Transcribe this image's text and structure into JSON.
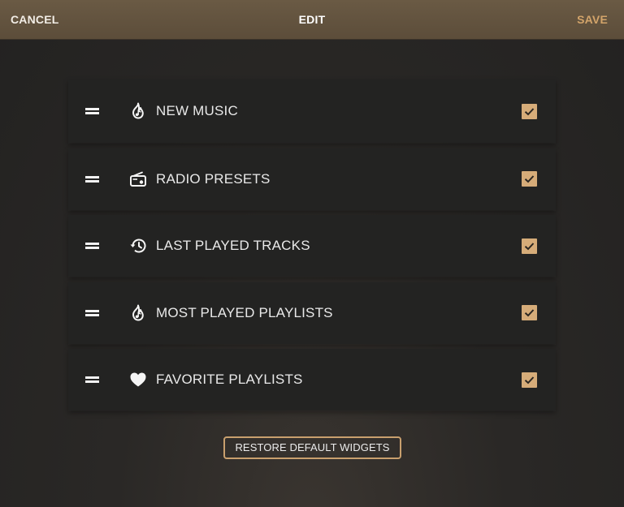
{
  "header": {
    "cancel_label": "CANCEL",
    "title": "EDIT",
    "save_label": "SAVE"
  },
  "widgets": [
    {
      "label": "NEW MUSIC",
      "icon": "flame-music-icon",
      "checked": true
    },
    {
      "label": "RADIO PRESETS",
      "icon": "radio-icon",
      "checked": true
    },
    {
      "label": "LAST PLAYED TRACKS",
      "icon": "history-icon",
      "checked": true
    },
    {
      "label": "MOST PLAYED PLAYLISTS",
      "icon": "flame-music-icon",
      "checked": true
    },
    {
      "label": "FAVORITE PLAYLISTS",
      "icon": "heart-icon",
      "checked": true
    }
  ],
  "restore_label": "RESTORE DEFAULT WIDGETS",
  "colors": {
    "accent": "#d6ac79",
    "header_bg": "#5c4d3a",
    "row_bg": "#232322",
    "page_bg": "#2a2826"
  }
}
